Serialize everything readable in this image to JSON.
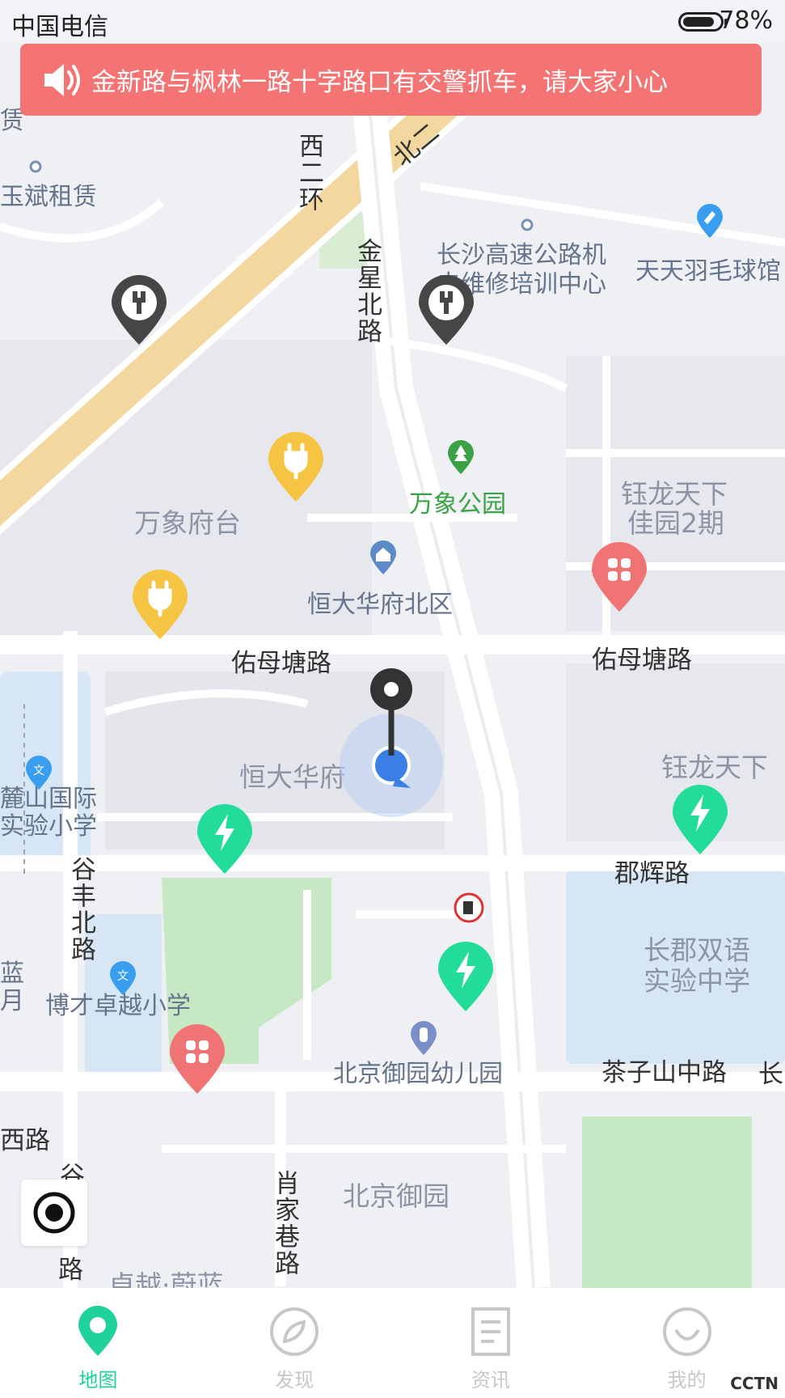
{
  "status_bar": {
    "carrier": "中国电信",
    "battery": "78%"
  },
  "alert": {
    "text": "金新路与枫林一路十字路口有交警抓车，请大家小心",
    "color": "#f47474"
  },
  "map": {
    "roads": {
      "xierhuan": "西二环",
      "bei": "北二",
      "jinxing": "金星北路",
      "youmu_left": "佑母塘路",
      "youmu_right": "佑母塘路",
      "junhui": "郡辉路",
      "gufeng": "谷丰北路",
      "chazi": "茶子山中路",
      "xiaojia": "肖家巷路",
      "gu": "谷",
      "lu": "路",
      "xilu": "西路",
      "chang": "长"
    },
    "places": {
      "zulin_top": "赁",
      "zulin": "玉斌租赁",
      "changsha_center": "长沙高速公路机",
      "changsha_center2": "电维修培训中心",
      "badminton": "天天羽毛球馆",
      "wanxiang_park": "万象公园",
      "wanxiang_fu": "万象府台",
      "yulong1": "钰龙天下",
      "yulong2": "佳园2期",
      "hengda_north": "恒大华府北区",
      "hengda": "恒大华府",
      "yulong_right": "钰龙天下",
      "lushan1": "麓山国际",
      "lushan2": "实验小学",
      "changjun1": "长郡双语",
      "changjun2": "实验中学",
      "bocai": "博才卓越小学",
      "beijing_kg": "北京御园幼儿园",
      "beijing_yuan": "北京御园",
      "zhuoyue": "卓越·蔚蓝",
      "lan": "蓝",
      "yue": "月"
    },
    "colors": {
      "road_main": "#f2d79e",
      "park": "#c6e8c3",
      "water": "#d6e6f5",
      "charger_green": "#22dc9a",
      "charger_yellow": "#f5c443",
      "service_gray": "#464646",
      "food_red": "#f17474"
    }
  },
  "nav": {
    "items": [
      {
        "label": "地图"
      },
      {
        "label": "发现"
      },
      {
        "label": "资讯"
      },
      {
        "label": "我的"
      }
    ],
    "active_color": "#1fd19a"
  },
  "watermark": "CCTN"
}
